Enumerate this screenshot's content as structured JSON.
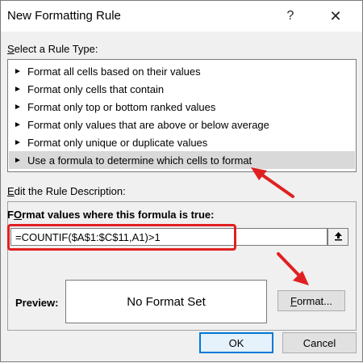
{
  "window": {
    "title": "New Formatting Rule",
    "help_label": "?",
    "close_label": "✕"
  },
  "rule_type": {
    "label_prefix": "",
    "label_accel": "S",
    "label_rest": "elect a Rule Type:",
    "items": [
      {
        "label": "Format all cells based on their values"
      },
      {
        "label": "Format only cells that contain"
      },
      {
        "label": "Format only top or bottom ranked values"
      },
      {
        "label": "Format only values that are above or below average"
      },
      {
        "label": "Format only unique or duplicate values"
      },
      {
        "label": "Use a formula to determine which cells to format",
        "selected": true
      }
    ]
  },
  "description": {
    "label_accel": "E",
    "label_rest": "dit the Rule Description:",
    "formula_label_accel": "O",
    "formula_label_pre": "F",
    "formula_label_rest": "rmat values where this formula is true:",
    "formula_value": "=COUNTIF($A$1:$C$11,A1)>1",
    "preview_label": "Preview:",
    "preview_text": "No Format Set",
    "format_button_accel": "F",
    "format_button_rest": "ormat..."
  },
  "footer": {
    "ok_label": "OK",
    "cancel_label": "Cancel"
  },
  "icons": {
    "bullet": "arrow-bullet-icon",
    "collapse": "collapse-dialog-icon"
  },
  "colors": {
    "highlight_red": "#e02020",
    "selected_row": "#d9d9d9",
    "ok_border": "#0078d7"
  }
}
